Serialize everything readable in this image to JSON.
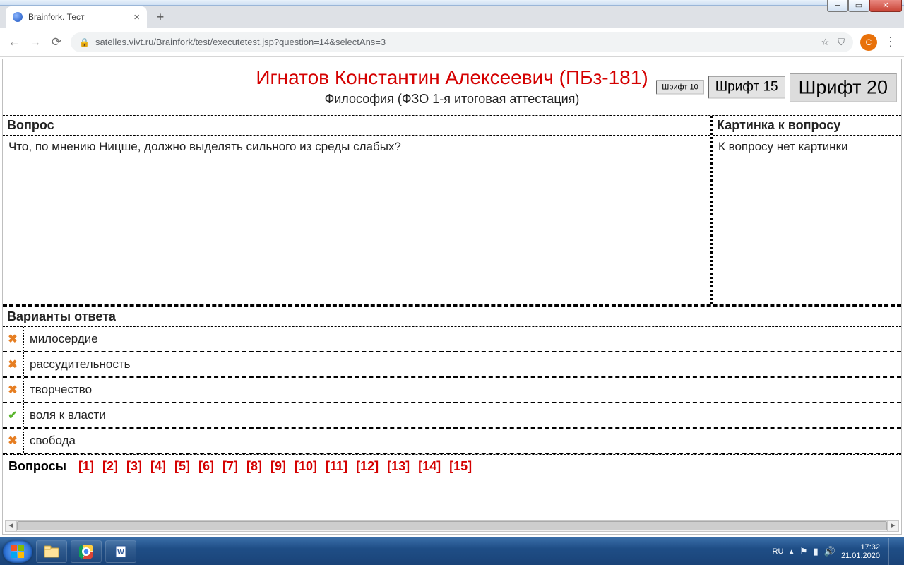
{
  "window": {
    "tab_title": "Brainfork. Тест",
    "url": "satelles.vivt.ru/Brainfork/test/executetest.jsp?question=14&selectAns=3",
    "avatar_letter": "C"
  },
  "header": {
    "student": "Игнатов Константин Алексеевич (ПБз-181)",
    "subject": "Философия (ФЗО 1-я итоговая аттестация)",
    "font_btn_10": "Шрифт 10",
    "font_btn_15": "Шрифт 15",
    "font_btn_20": "Шрифт 20"
  },
  "labels": {
    "question": "Вопрос",
    "question_image": "Картинка к вопросу",
    "no_image": "К вопросу нет картинки",
    "answers": "Варианты ответа",
    "nav": "Вопросы"
  },
  "question_text": "Что, по мнению Ницше, должно выделять сильного из среды слабых?",
  "answers": [
    {
      "status": "wrong",
      "text": "милосердие"
    },
    {
      "status": "wrong",
      "text": "рассудительность"
    },
    {
      "status": "wrong",
      "text": "творчество"
    },
    {
      "status": "correct",
      "text": "воля к власти"
    },
    {
      "status": "wrong",
      "text": "свобода"
    }
  ],
  "nav": {
    "total": 15,
    "current": 15
  },
  "tray": {
    "lang": "RU",
    "time": "17:32",
    "date": "21.01.2020"
  }
}
